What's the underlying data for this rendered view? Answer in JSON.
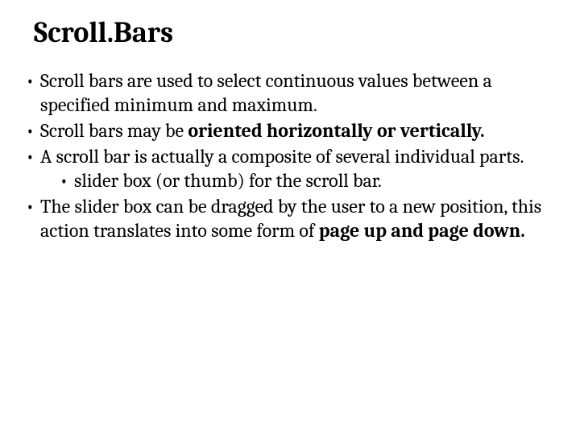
{
  "title": "Scroll.Bars",
  "bullets": {
    "b1": "Scroll bars are used to select continuous values between a specified minimum and maximum.",
    "b2a": "Scroll bars may be ",
    "b2b": "oriented horizontally or vertically.",
    "b3": "A scroll bar is actually a composite of several individual parts.",
    "b3sub": "slider box (or thumb) for the scroll bar.",
    "b4a": "The slider box can be dragged by the user to a new position, this action translates into some form of ",
    "b4b": "page up and page down."
  }
}
